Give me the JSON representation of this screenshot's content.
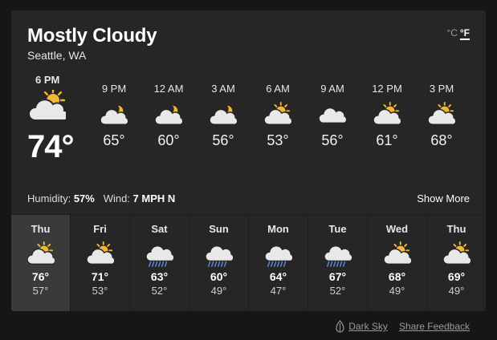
{
  "current": {
    "condition": "Mostly Cloudy",
    "location": "Seattle, WA",
    "time": "6 PM",
    "temp": "74°",
    "icon": "partly-cloudy-day-icon"
  },
  "units": {
    "celsius": "°C",
    "fahrenheit": "°F",
    "selected": "fahrenheit"
  },
  "hourly": [
    {
      "time": "9 PM",
      "temp": "65°",
      "icon": "partly-cloudy-night-icon"
    },
    {
      "time": "12 AM",
      "temp": "60°",
      "icon": "partly-cloudy-night-icon"
    },
    {
      "time": "3 AM",
      "temp": "56°",
      "icon": "partly-cloudy-night-icon"
    },
    {
      "time": "6 AM",
      "temp": "53°",
      "icon": "partly-cloudy-day-icon"
    },
    {
      "time": "9 AM",
      "temp": "56°",
      "icon": "cloudy-icon"
    },
    {
      "time": "12 PM",
      "temp": "61°",
      "icon": "partly-cloudy-day-icon"
    },
    {
      "time": "3 PM",
      "temp": "68°",
      "icon": "partly-cloudy-day-icon"
    }
  ],
  "details": {
    "humidity_label": "Humidity:",
    "humidity": "57%",
    "wind_label": "Wind:",
    "wind": "7 MPH N",
    "show_more": "Show More"
  },
  "daily": [
    {
      "day": "Thu",
      "high": "76°",
      "low": "57°",
      "icon": "partly-cloudy-day-icon",
      "selected": true
    },
    {
      "day": "Fri",
      "high": "71°",
      "low": "53°",
      "icon": "partly-cloudy-day-icon"
    },
    {
      "day": "Sat",
      "high": "63°",
      "low": "52°",
      "icon": "rain-icon"
    },
    {
      "day": "Sun",
      "high": "60°",
      "low": "49°",
      "icon": "rain-icon"
    },
    {
      "day": "Mon",
      "high": "64°",
      "low": "47°",
      "icon": "rain-icon"
    },
    {
      "day": "Tue",
      "high": "67°",
      "low": "52°",
      "icon": "rain-icon"
    },
    {
      "day": "Wed",
      "high": "68°",
      "low": "49°",
      "icon": "partly-cloudy-day-icon"
    },
    {
      "day": "Thu",
      "high": "69°",
      "low": "49°",
      "icon": "partly-cloudy-day-icon"
    }
  ],
  "footer": {
    "dark_sky": "Dark Sky",
    "share_feedback": "Share Feedback"
  },
  "colors": {
    "card": "#262626",
    "sun": "#f5b731",
    "moon": "#f5b731",
    "cloud": "#e8e8e8",
    "rain": "#5b86d6"
  }
}
